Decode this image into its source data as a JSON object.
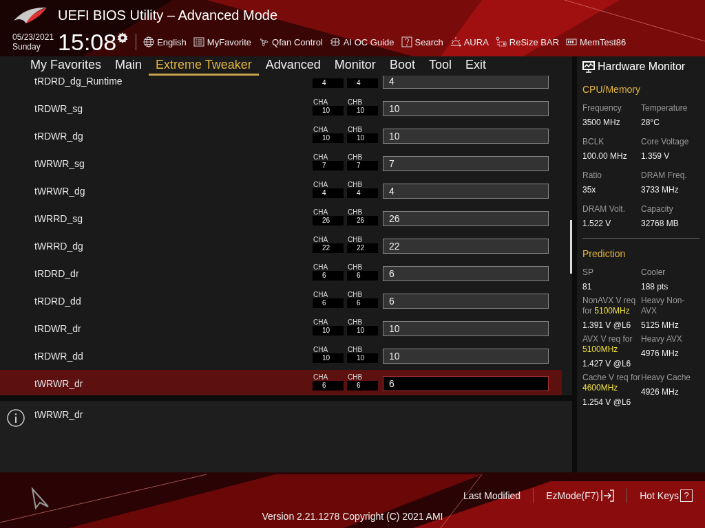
{
  "header": {
    "title": "UEFI BIOS Utility – Advanced Mode",
    "date": "05/23/2021",
    "day": "Sunday",
    "time": "15:08",
    "tools": [
      "English",
      "MyFavorite",
      "Qfan Control",
      "AI OC Guide",
      "Search",
      "AURA",
      "ReSize BAR",
      "MemTest86"
    ]
  },
  "tabs": [
    {
      "label": "My Favorites",
      "selected": false
    },
    {
      "label": "Main",
      "selected": false
    },
    {
      "label": "Extreme Tweaker",
      "selected": true
    },
    {
      "label": "Advanced",
      "selected": false
    },
    {
      "label": "Monitor",
      "selected": false
    },
    {
      "label": "Boot",
      "selected": false
    },
    {
      "label": "Tool",
      "selected": false
    },
    {
      "label": "Exit",
      "selected": false
    }
  ],
  "rows": [
    {
      "label": "tRDRD_dg_Runtime",
      "cha": "4",
      "chb": "4",
      "value": "4",
      "selected": false
    },
    {
      "label": "tRDWR_sg",
      "cha_label": "CHA",
      "chb_label": "CHB",
      "cha": "10",
      "chb": "10",
      "value": "10",
      "selected": false
    },
    {
      "label": "tRDWR_dg",
      "cha_label": "CHA",
      "chb_label": "CHB",
      "cha": "10",
      "chb": "10",
      "value": "10",
      "selected": false
    },
    {
      "label": "tWRWR_sg",
      "cha_label": "CHA",
      "chb_label": "CHB",
      "cha": "7",
      "chb": "7",
      "value": "7",
      "selected": false
    },
    {
      "label": "tWRWR_dg",
      "cha_label": "CHA",
      "chb_label": "CHB",
      "cha": "4",
      "chb": "4",
      "value": "4",
      "selected": false
    },
    {
      "label": "tWRRD_sg",
      "cha_label": "CHA",
      "chb_label": "CHB",
      "cha": "26",
      "chb": "26",
      "value": "26",
      "selected": false
    },
    {
      "label": "tWRRD_dg",
      "cha_label": "CHA",
      "chb_label": "CHB",
      "cha": "22",
      "chb": "22",
      "value": "22",
      "selected": false
    },
    {
      "label": "tRDRD_dr",
      "cha_label": "CHA",
      "chb_label": "CHB",
      "cha": "6",
      "chb": "6",
      "value": "6",
      "selected": false
    },
    {
      "label": "tRDRD_dd",
      "cha_label": "CHA",
      "chb_label": "CHB",
      "cha": "6",
      "chb": "6",
      "value": "6",
      "selected": false
    },
    {
      "label": "tRDWR_dr",
      "cha_label": "CHA",
      "chb_label": "CHB",
      "cha": "10",
      "chb": "10",
      "value": "10",
      "selected": false
    },
    {
      "label": "tRDWR_dd",
      "cha_label": "CHA",
      "chb_label": "CHB",
      "cha": "10",
      "chb": "10",
      "value": "10",
      "selected": false
    },
    {
      "label": "tWRWR_dr",
      "cha_label": "CHA",
      "chb_label": "CHB",
      "cha": "6",
      "chb": "6",
      "value": "6",
      "selected": true
    }
  ],
  "help": {
    "text": "tWRWR_dr"
  },
  "hardware_monitor": {
    "title": "Hardware Monitor",
    "sections": [
      {
        "title": "CPU/Memory",
        "items": [
          {
            "label": "Frequency",
            "value": "3500 MHz"
          },
          {
            "label": "Temperature",
            "value": "28°C"
          },
          {
            "label": "BCLK",
            "value": "100.00 MHz"
          },
          {
            "label": "Core Voltage",
            "value": "1.359 V"
          },
          {
            "label": "Ratio",
            "value": "35x"
          },
          {
            "label": "DRAM Freq.",
            "value": "3733 MHz"
          },
          {
            "label": "DRAM Volt.",
            "value": "1.522 V"
          },
          {
            "label": "Capacity",
            "value": "32768 MB"
          }
        ]
      },
      {
        "title": "Prediction",
        "items": [
          {
            "label": "SP",
            "value": "81"
          },
          {
            "label": "Cooler",
            "value": "188 pts"
          },
          {
            "label": "NonAVX V req for **5100MHz**",
            "value": "1.391 V @L6"
          },
          {
            "label": "Heavy Non-AVX",
            "value": "5125 MHz"
          },
          {
            "label": "AVX V req  for **5100MHz**",
            "value": "1.427 V @L6"
          },
          {
            "label": "Heavy AVX",
            "value": "4976 MHz"
          },
          {
            "label": "Cache V req for **4600MHz**",
            "value": "1.254 V @L6"
          },
          {
            "label": "Heavy Cache",
            "value": "4926 MHz"
          }
        ]
      }
    ]
  },
  "footer": {
    "last_modified": "Last Modified",
    "ezmode": "EzMode(F7)",
    "hotkeys": "Hot Keys",
    "hotkeys_key": "?",
    "version": "Version 2.21.1278 Copyright (C) 2021 AMI"
  }
}
